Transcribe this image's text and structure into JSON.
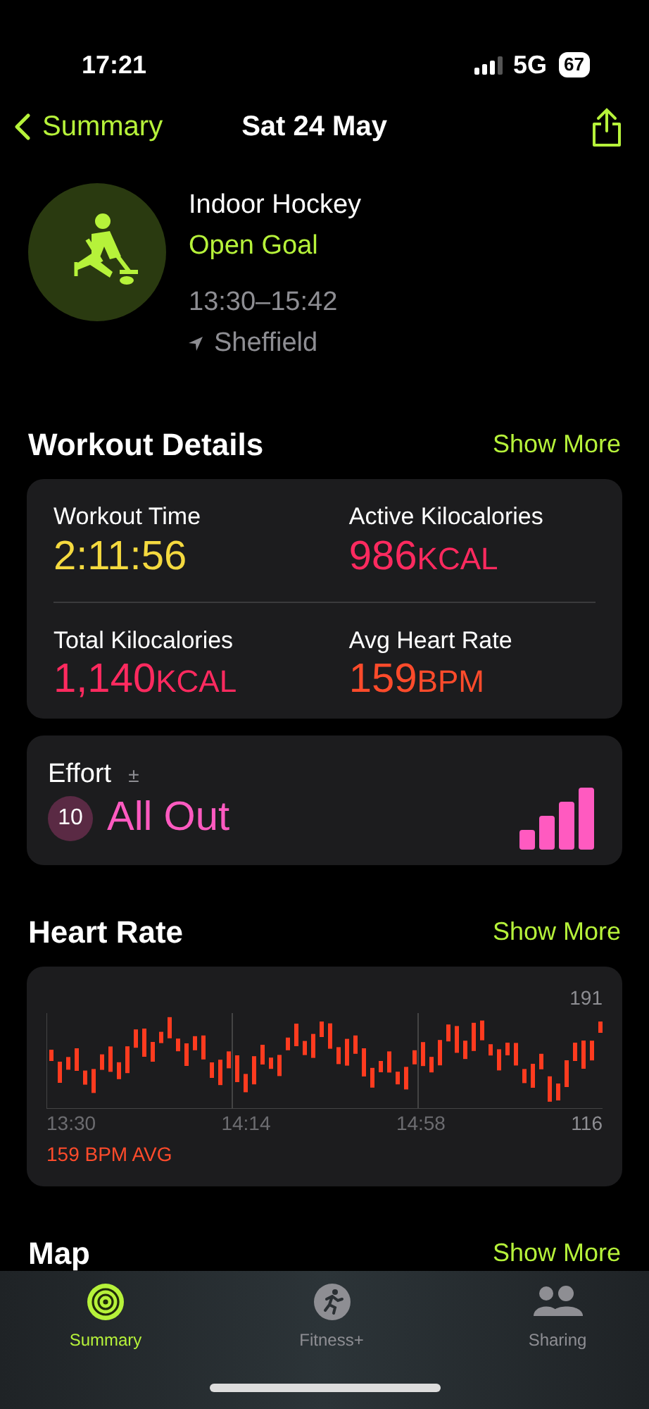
{
  "status_bar": {
    "time": "17:21",
    "network": "5G",
    "battery": "67"
  },
  "nav": {
    "back": "Summary",
    "title": "Sat 24 May"
  },
  "workout": {
    "type": "Indoor Hockey",
    "goal": "Open Goal",
    "time_range": "13:30–15:42",
    "location": "Sheffield"
  },
  "details": {
    "title": "Workout Details",
    "more": "Show More",
    "metrics": [
      {
        "label": "Workout Time",
        "value": "2:11:56",
        "color": "#f4d93f"
      },
      {
        "label": "Active Kilocalories",
        "value": "986",
        "unit": "KCAL",
        "color": "#ff2a5f"
      },
      {
        "label": "Total Kilocalories",
        "value": "1,140",
        "unit": "KCAL",
        "color": "#ff2a5f"
      },
      {
        "label": "Avg Heart Rate",
        "value": "159",
        "unit": "BPM",
        "color": "#ff4b2b"
      }
    ]
  },
  "effort": {
    "label": "Effort",
    "symbol": "±",
    "score": "10",
    "rating": "All Out",
    "level": 1
  },
  "heart_rate": {
    "title": "Heart Rate",
    "more": "Show More",
    "max": "191",
    "min": "116",
    "times": [
      "13:30",
      "14:14",
      "14:58"
    ],
    "average": "159 BPM AVG"
  },
  "map": {
    "title": "Map",
    "more": "Show More"
  },
  "tabs": [
    {
      "label": "Summary",
      "selected": true
    },
    {
      "label": "Fitness+",
      "selected": false
    },
    {
      "label": "Sharing",
      "selected": false
    }
  ]
}
